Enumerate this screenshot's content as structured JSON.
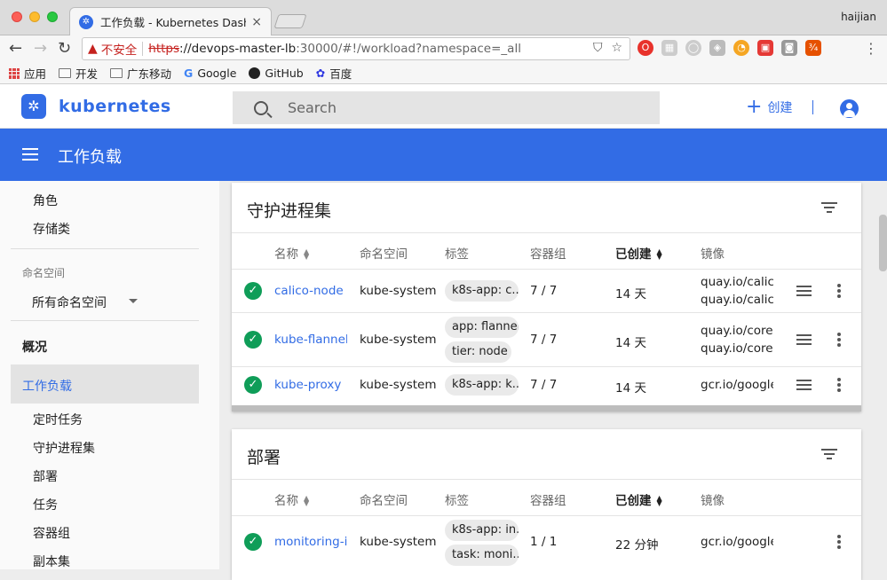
{
  "browser": {
    "tab_title": "工作负载 - Kubernetes Dashbo",
    "user": "haijian",
    "url_insecure_label": "不安全",
    "url_scheme": "https",
    "url_host": "://devops-master-lb",
    "url_path": ":30000/#!/workload?namespace=_all",
    "bookmarks": [
      "应用",
      "开发",
      "广东移动",
      "Google",
      "GitHub",
      "百度"
    ]
  },
  "header": {
    "logo_text": "kubernetes",
    "search_placeholder": "Search",
    "create_label": "创建"
  },
  "titlebar": {
    "title": "工作负载"
  },
  "sidebar": {
    "items_top": [
      "角色",
      "存储类"
    ],
    "namespace_label": "命名空间",
    "namespace_value": "所有命名空间",
    "overview": "概况",
    "active": "工作负载",
    "items": [
      "定时任务",
      "守护进程集",
      "部署",
      "任务",
      "容器组",
      "副本集"
    ]
  },
  "columns": {
    "name": "名称",
    "namespace": "命名空间",
    "labels": "标签",
    "pods": "容器组",
    "created": "已创建",
    "images": "镜像"
  },
  "daemonsets": {
    "title": "守护进程集",
    "rows": [
      {
        "name": "calico-node",
        "namespace": "kube-system",
        "labels": [
          "k8s-app: c..."
        ],
        "pods": "7 / 7",
        "created": "14 天",
        "images": [
          "quay.io/calic",
          "quay.io/calic"
        ]
      },
      {
        "name": "kube-flannel-",
        "namespace": "kube-system",
        "labels": [
          "app: flannel",
          "tier: node"
        ],
        "pods": "7 / 7",
        "created": "14 天",
        "images": [
          "quay.io/core",
          "quay.io/core"
        ]
      },
      {
        "name": "kube-proxy",
        "namespace": "kube-system",
        "labels": [
          "k8s-app: k..."
        ],
        "pods": "7 / 7",
        "created": "14 天",
        "images": [
          "gcr.io/google"
        ]
      }
    ]
  },
  "deployments": {
    "title": "部署",
    "rows": [
      {
        "name": "monitoring-ir",
        "namespace": "kube-system",
        "labels": [
          "k8s-app: in...",
          "task: moni..."
        ],
        "pods": "1 / 1",
        "created": "22 分钟",
        "images": [
          "gcr.io/google"
        ]
      }
    ]
  },
  "colors": {
    "brand": "#326ce5",
    "ok": "#0f9d58"
  }
}
